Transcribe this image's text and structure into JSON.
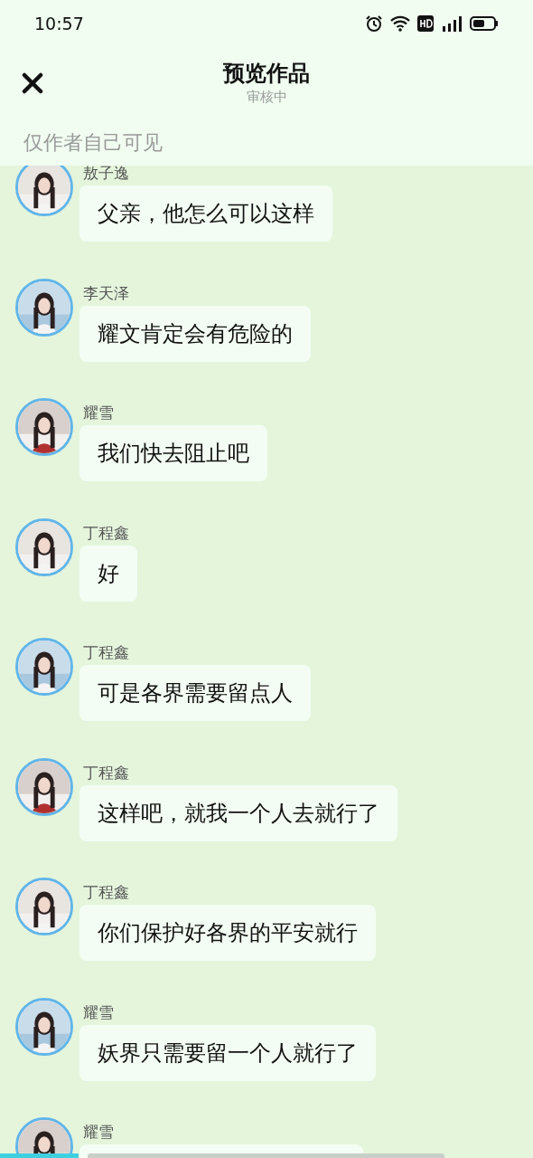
{
  "status_bar": {
    "time": "10:57"
  },
  "header": {
    "title": "预览作品",
    "subtitle": "审核中",
    "notice": "仅作者自己可见"
  },
  "messages": [
    {
      "name": "敖子逸",
      "text": "父亲，他怎么可以这样"
    },
    {
      "name": "李天泽",
      "text": "耀文肯定会有危险的"
    },
    {
      "name": "耀雪",
      "text": "我们快去阻止吧"
    },
    {
      "name": "丁程鑫",
      "text": "好"
    },
    {
      "name": "丁程鑫",
      "text": "可是各界需要留点人"
    },
    {
      "name": "丁程鑫",
      "text": "这样吧，就我一个人去就行了"
    },
    {
      "name": "丁程鑫",
      "text": "你们保护好各界的平安就行"
    },
    {
      "name": "耀雪",
      "text": "妖界只需要留一个人就行了"
    },
    {
      "name": "耀雪"
    }
  ]
}
